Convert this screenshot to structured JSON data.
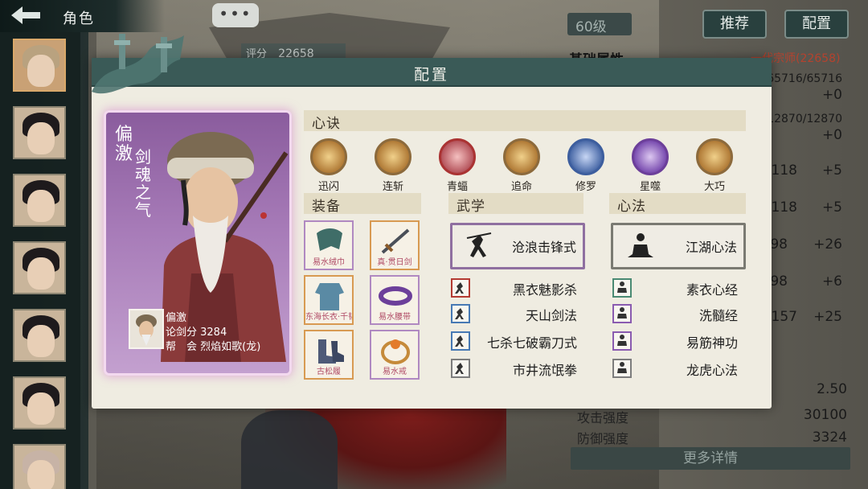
{
  "top": {
    "title": "角色",
    "chat": "•••"
  },
  "background": {
    "score_label": "评分",
    "score_value": "22658",
    "level": "60级",
    "recommend_button": "推荐",
    "config_button": "配置",
    "stats_heading": "基础属性",
    "rank_text": "一代宗师(22658)",
    "stat_values": [
      "65716/65716",
      "+0",
      "12870/12870",
      "+0",
      "118",
      "+5",
      "118",
      "+5",
      "98",
      "+26",
      "98",
      "+6",
      "157",
      "+25",
      "2.50",
      "30100",
      "3324"
    ],
    "attack_label": "攻击强度",
    "defense_label": "防御强度",
    "more_button": "更多详情"
  },
  "modal": {
    "title": "配置",
    "character": {
      "name": "偏激",
      "tag": "剑魂之气",
      "info_name": "偏激",
      "info_score": "论剑分 3284",
      "info_guild": "帮　会 烈焰如歌(龙)"
    },
    "xinjue": {
      "heading": "心诀",
      "skills": [
        "迅闪",
        "连斩",
        "青蝠",
        "追命",
        "修罗",
        "星噬",
        "大巧"
      ]
    },
    "equipment": {
      "heading": "装备",
      "items": [
        "易水绒巾",
        "真·贯日剑",
        "东海长衣·千韧",
        "易水腰带",
        "古松履",
        "易水戒"
      ]
    },
    "wuxue": {
      "heading": "武学",
      "main": "沧浪击锋式",
      "list": [
        "黑衣魅影杀",
        "天山剑法",
        "七杀七破霸刀式",
        "市井流氓拳"
      ]
    },
    "xinfa": {
      "heading": "心法",
      "main": "江湖心法",
      "list": [
        "素衣心经",
        "洗髓经",
        "易筋神功",
        "龙虎心法"
      ]
    }
  },
  "colors": {
    "header": "#3a5a57",
    "panel": "#efece1",
    "card": "#a77bb8",
    "accent_red": "#b5422e"
  }
}
